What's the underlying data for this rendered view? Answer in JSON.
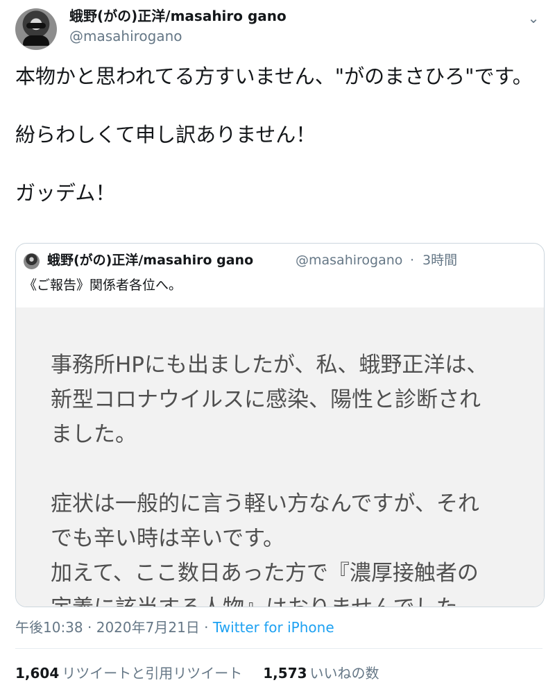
{
  "author": {
    "display_name": "蛾野(がの)正洋/masahiro gano",
    "handle": "@masahirogano",
    "menu_icon": "chevron-down-icon"
  },
  "tweet": {
    "paragraphs": [
      "本物かと思われてる方すいません、\"がのまさひろ\"です。",
      "紛らわしくて申し訳ありません！",
      "ガッデム！"
    ]
  },
  "quote": {
    "display_name": "蛾野(がの)正洋/masahiro gano",
    "handle": "@masahirogano",
    "separator": "·",
    "time": "3時間",
    "text": "《ご報告》関係者各位へ。",
    "image_text": [
      "事務所HPにも出ましたが、私、蛾野正洋は、",
      "新型コロナウイルスに感染、陽性と診断され",
      "ました。",
      "症状は一般的に言う軽い方なんですが、それ",
      "でも辛い時は辛いです。",
      "加えて、ここ数日あった方で『濃厚接触者の",
      "定義に該当する人物』はおりませんでした。"
    ]
  },
  "meta": {
    "time": "午後10:38",
    "separator_1": " · ",
    "date": "2020年7月21日",
    "separator_2": " · ",
    "source": "Twitter for iPhone"
  },
  "stats": {
    "retweets_count": "1,604",
    "retweets_label": "リツイートと引用リツイート",
    "likes_count": "1,573",
    "likes_label": "いいねの数"
  },
  "colors": {
    "text": "#14171a",
    "secondary": "#657786",
    "link": "#1da1f2",
    "border": "#ccd6dd",
    "image_background": "#f2f2f2"
  }
}
